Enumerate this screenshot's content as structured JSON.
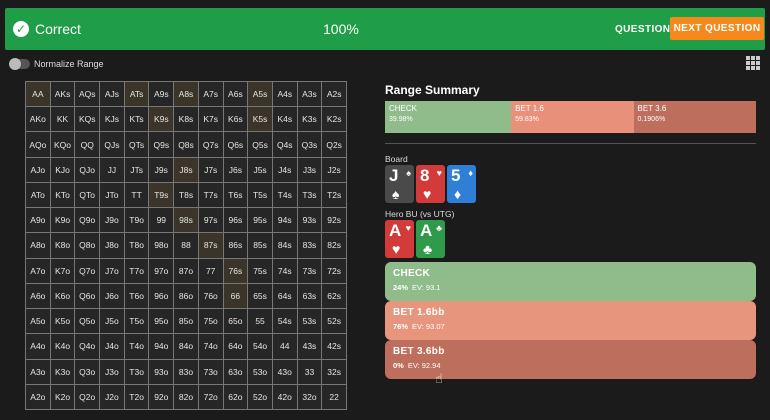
{
  "topbar": {
    "status": "Correct",
    "percent": "100%",
    "question_label": "QUESTION",
    "next_label": "NEXT QUESTION"
  },
  "normalize_label": "Normalize Range",
  "matrix": [
    [
      "AA",
      "AKs",
      "AQs",
      "AJs",
      "ATs",
      "A9s",
      "A8s",
      "A7s",
      "A6s",
      "A5s",
      "A4s",
      "A3s",
      "A2s"
    ],
    [
      "AKo",
      "KK",
      "KQs",
      "KJs",
      "KTs",
      "K9s",
      "K8s",
      "K7s",
      "K6s",
      "K5s",
      "K4s",
      "K3s",
      "K2s"
    ],
    [
      "AQo",
      "KQo",
      "QQ",
      "QJs",
      "QTs",
      "Q9s",
      "Q8s",
      "Q7s",
      "Q6s",
      "Q5s",
      "Q4s",
      "Q3s",
      "Q2s"
    ],
    [
      "AJo",
      "KJo",
      "QJo",
      "JJ",
      "JTs",
      "J9s",
      "J8s",
      "J7s",
      "J6s",
      "J5s",
      "J4s",
      "J3s",
      "J2s"
    ],
    [
      "ATo",
      "KTo",
      "QTo",
      "JTo",
      "TT",
      "T9s",
      "T8s",
      "T7s",
      "T6s",
      "T5s",
      "T4s",
      "T3s",
      "T2s"
    ],
    [
      "A9o",
      "K9o",
      "Q9o",
      "J9o",
      "T9o",
      "99",
      "98s",
      "97s",
      "96s",
      "95s",
      "94s",
      "93s",
      "92s"
    ],
    [
      "A8o",
      "K8o",
      "Q8o",
      "J8o",
      "T8o",
      "98o",
      "88",
      "87s",
      "86s",
      "85s",
      "84s",
      "83s",
      "82s"
    ],
    [
      "A7o",
      "K7o",
      "Q7o",
      "J7o",
      "T7o",
      "97o",
      "87o",
      "77",
      "76s",
      "75s",
      "74s",
      "73s",
      "72s"
    ],
    [
      "A6o",
      "K6o",
      "Q6o",
      "J6o",
      "T6o",
      "96o",
      "86o",
      "76o",
      "66",
      "65s",
      "64s",
      "63s",
      "62s"
    ],
    [
      "A5o",
      "K5o",
      "Q5o",
      "J5o",
      "T5o",
      "95o",
      "85o",
      "75o",
      "65o",
      "55",
      "54s",
      "53s",
      "52s"
    ],
    [
      "A4o",
      "K4o",
      "Q4o",
      "J4o",
      "T4o",
      "94o",
      "84o",
      "74o",
      "64o",
      "54o",
      "44",
      "43s",
      "42s"
    ],
    [
      "A3o",
      "K3o",
      "Q3o",
      "J3o",
      "T3o",
      "93o",
      "83o",
      "73o",
      "63o",
      "53o",
      "43o",
      "33",
      "32s"
    ],
    [
      "A2o",
      "K2o",
      "Q2o",
      "J2o",
      "T2o",
      "92o",
      "82o",
      "72o",
      "62o",
      "52o",
      "42o",
      "32o",
      "22"
    ]
  ],
  "summary": {
    "title": "Range Summary",
    "segments": [
      {
        "name": "CHECK",
        "value": "39.98%",
        "share": 0.34,
        "color": "#8fbc8a"
      },
      {
        "name": "BET 1.6",
        "value": "59.83%",
        "share": 0.33,
        "color": "#e8907a"
      },
      {
        "name": "BET 3.6",
        "value": "0.1906%",
        "share": 0.33,
        "color": "#bd6e5c"
      }
    ]
  },
  "board": {
    "label": "Board",
    "cards": [
      {
        "rank": "J",
        "suit": "♠",
        "color": "#4a4a4a"
      },
      {
        "rank": "8",
        "suit": "♥",
        "color": "#d33a3a"
      },
      {
        "rank": "5",
        "suit": "♦",
        "color": "#2f7fd6"
      }
    ]
  },
  "hero": {
    "label": "Hero BU (vs UTG)",
    "cards": [
      {
        "rank": "A",
        "suit": "♥",
        "color": "#d33a3a"
      },
      {
        "rank": "A",
        "suit": "♣",
        "color": "#2e9a4a"
      }
    ]
  },
  "options": [
    {
      "name": "CHECK",
      "freq": "24%",
      "ev": "EV: 93.1",
      "color": "#8fbc8a"
    },
    {
      "name": "BET 1.6bb",
      "freq": "76%",
      "ev": "EV: 93.07",
      "color": "#e8957e"
    },
    {
      "name": "BET 3.6bb",
      "freq": "0%",
      "ev": "EV: 92.94",
      "color": "#bd6e5c"
    }
  ]
}
